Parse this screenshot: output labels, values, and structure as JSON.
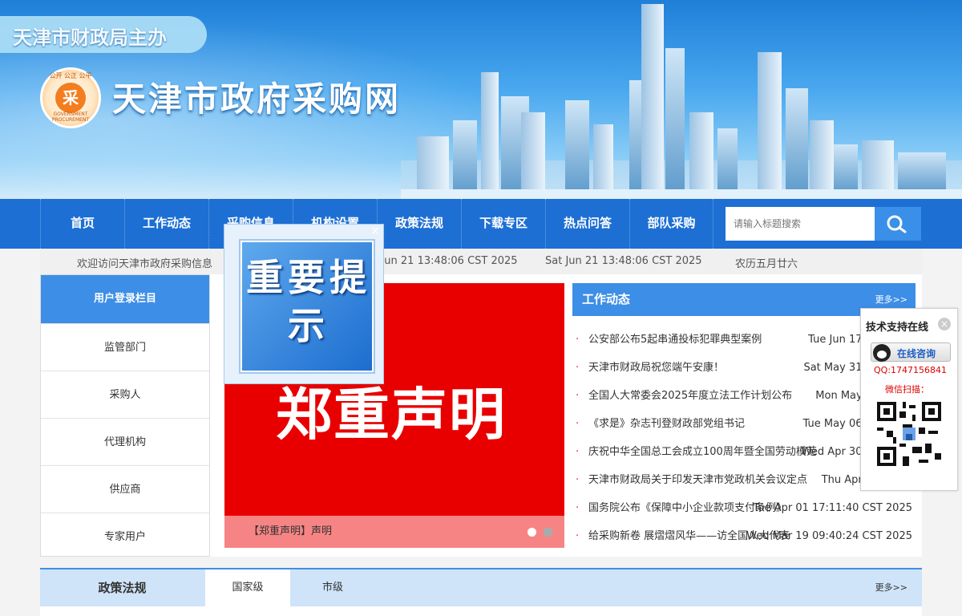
{
  "header": {
    "sponsor": "天津市财政局主办",
    "site_title": "天津市政府采购网",
    "logo_text": "采",
    "logo_tags": "公开 公正 公平",
    "logo_bottom": "GOVERNMENT PROCUREMENT"
  },
  "nav": {
    "items": [
      "首页",
      "工作动态",
      "采购信息",
      "机构设置",
      "政策法规",
      "下载专区",
      "热点问答",
      "部队采购"
    ],
    "search_placeholder": "请输入标题搜索"
  },
  "ticker": {
    "welcome": "欢迎访问天津市政府采购信息",
    "time1": "Sat Jun 21 13:48:06 CST 2025",
    "time2": "Sat Jun 21 13:48:06 CST 2025",
    "lunar": "农历五月廿六"
  },
  "sidebar": {
    "head": "用户登录栏目",
    "items": [
      "监管部门",
      "采购人",
      "代理机构",
      "供应商",
      "专家用户"
    ]
  },
  "slide": {
    "headline": "郑重声明",
    "caption": "【郑重声明】声明"
  },
  "notice": {
    "text": "重要提示",
    "close": "×"
  },
  "news": {
    "title": "工作动态",
    "more": "更多>>",
    "items": [
      {
        "title": "公安部公布5起串通投标犯罪典型案例",
        "date": "Tue Jun 17 11:04:11"
      },
      {
        "title": "天津市财政局祝您端午安康！",
        "date": "Sat May 31 09:26:29"
      },
      {
        "title": "全国人大常委会2025年度立法工作计划公布",
        "date": "Mon May 19 21:16"
      },
      {
        "title": "《求是》杂志刊登财政部党组书记",
        "date": "Tue May 06 13:23:20"
      },
      {
        "title": "庆祝中华全国总工会成立100周年暨全国劳动模范",
        "date": "Wed Apr 30 17:57:19"
      },
      {
        "title": "天津市财政局关于印发天津市党政机关会议定点",
        "date": "Thu Apr 17 18:30"
      },
      {
        "title": "国务院公布《保障中小企业款项支付条例》",
        "date": "Tue Apr 01 17:11:40 CST 2025"
      },
      {
        "title": "给采购新卷 展熠熠风华——访全国人大代表",
        "date": "Wed Mar 19 09:40:24 CST 2025"
      }
    ]
  },
  "support": {
    "title": "技术支持在线",
    "consult": "在线咨询",
    "qq": "QQ:1747156841",
    "scan": "微信扫描："
  },
  "policy": {
    "title": "政策法规",
    "tabs": [
      "国家级",
      "市级"
    ],
    "more": "更多>>"
  }
}
